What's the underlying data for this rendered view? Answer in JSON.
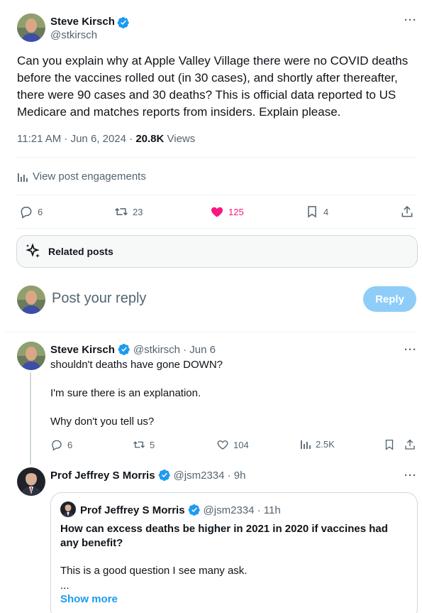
{
  "main_post": {
    "author_name": "Steve Kirsch",
    "handle": "@stkirsch",
    "text": "Can you explain why at Apple Valley Village there were no COVID deaths before the vaccines rolled out (in 30 cases), and shortly after thereafter, there were 90 cases and 30 deaths? This is official data reported to US Medicare and matches reports from insiders. Explain please.",
    "time": "11:21 AM · Jun 6, 2024 · ",
    "views_count": "20.8K",
    "views_label": " Views",
    "engagements_label": "View post engagements",
    "replies": "6",
    "reposts": "23",
    "likes": "125",
    "bookmarks": "4",
    "related_label": "Related posts"
  },
  "reply_box": {
    "placeholder": "Post your reply",
    "button_label": "Reply"
  },
  "reply1": {
    "author_name": "Steve Kirsch",
    "meta": "@stkirsch · Jun 6",
    "line1": "shouldn't deaths have gone DOWN?",
    "line2": "I'm sure there is an explanation.",
    "line3": "Why don't you tell us?",
    "replies": "6",
    "reposts": "5",
    "likes": "104",
    "views": "2.5K"
  },
  "reply2": {
    "author_name": "Prof Jeffrey S Morris",
    "meta": "@jsm2334 · 9h",
    "quote": {
      "author_name": "Prof Jeffrey S Morris",
      "meta": "@jsm2334 · 11h",
      "bold_text": "How can excess deaths be higher in 2021 in 2020 if vaccines had any benefit?",
      "text": "This is a good question I see many ask.",
      "ellipsis": "...",
      "show_more": "Show more"
    }
  },
  "colors": {
    "accent": "#1d9bf0",
    "like": "#f91880",
    "reply_button_disabled": "#8ecdf8"
  }
}
